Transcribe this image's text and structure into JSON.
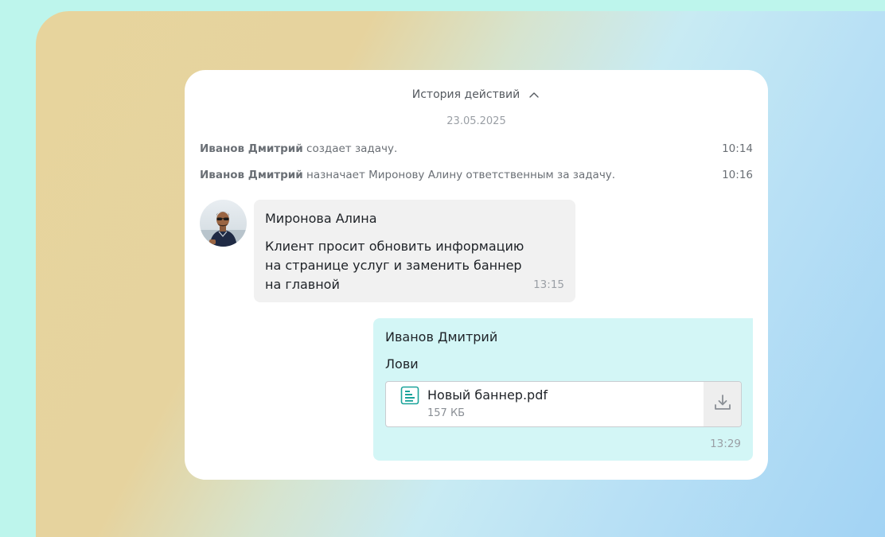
{
  "history": {
    "title": "История действий",
    "date": "23.05.2025",
    "entries": [
      {
        "actor": "Иванов Дмитрий",
        "action": "создает задачу.",
        "time": "10:14"
      },
      {
        "actor": "Иванов Дмитрий",
        "action": "назначает Миронову Алину ответственным за задачу.",
        "time": "10:16"
      }
    ]
  },
  "messages": [
    {
      "author": "Миронова Алина",
      "lines": [
        "Клиент просит обновить информацию",
        "на странице услуг и заменить баннер",
        "на главной"
      ],
      "time": "13:15"
    },
    {
      "author": "Иванов Дмитрий",
      "text": "Лови",
      "file": {
        "name": "Новый баннер.pdf",
        "size": "157 КБ"
      },
      "time": "13:29"
    }
  ],
  "colors": {
    "incoming_bubble": "#f1f1f1",
    "outgoing_bubble": "#d3f6f6",
    "file_icon": "#1aa39a"
  },
  "icons": {
    "collapse": "chevron-up-icon",
    "file": "document-icon",
    "download": "download-icon"
  }
}
